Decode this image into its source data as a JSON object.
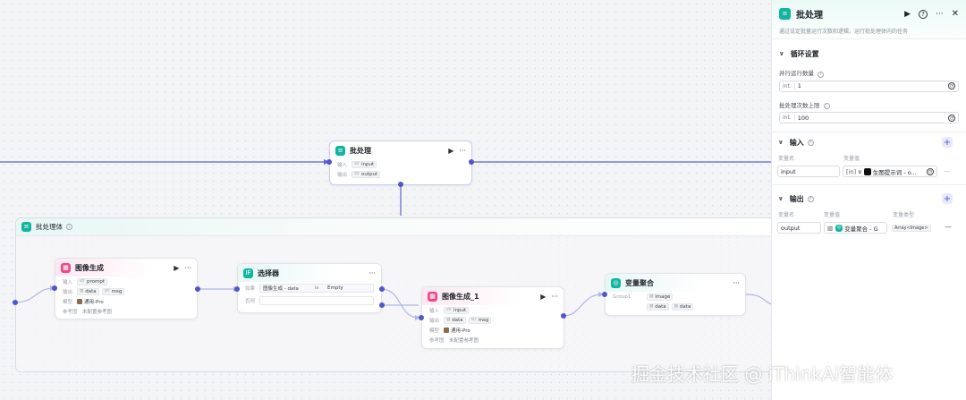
{
  "batch_node": {
    "title": "批处理",
    "input_label": "输入",
    "input_var": "input",
    "output_label": "输出",
    "output_var": "output",
    "type_tag": "str"
  },
  "group": {
    "title": "批处理体"
  },
  "image_gen_1": {
    "title": "图像生成",
    "rows": [
      {
        "label": "输入",
        "vars": [
          "prompt"
        ]
      },
      {
        "label": "输出",
        "vars": [
          "data",
          "msg"
        ]
      },
      {
        "label": "模型",
        "vars": [
          "通用-Pro"
        ]
      },
      {
        "label": "参考图",
        "vars": [
          "未配置参考图"
        ]
      }
    ]
  },
  "selector": {
    "title": "选择器",
    "cond_label": "如果",
    "cond_left": "图像生成 - data",
    "cond_op": "is",
    "cond_right": "Empty",
    "else_label": "否则"
  },
  "image_gen_2": {
    "title": "图像生成_1",
    "rows": [
      {
        "label": "输入",
        "vars": [
          "input"
        ]
      },
      {
        "label": "输出",
        "vars": [
          "data",
          "msg"
        ]
      },
      {
        "label": "模型",
        "vars": [
          "通用-Pro"
        ]
      },
      {
        "label": "参考图",
        "vars": [
          "未配置参考图"
        ]
      }
    ]
  },
  "aggregator": {
    "title": "变量聚合",
    "group_label": "Group1",
    "vars": [
      "image",
      "data",
      "data"
    ]
  },
  "panel": {
    "title": "批处理",
    "description": "通过设定批量运行次数和逻辑，运行批处理体内的任务",
    "loop_section": "循环设置",
    "parallel_label": "并行运行数量",
    "parallel_prefix": "int.",
    "parallel_value": "1",
    "max_label": "批处理次数上限",
    "max_prefix": "int.",
    "max_value": "100",
    "input_section": "输入",
    "var_name_col": "变量名",
    "var_value_col": "变量值",
    "input_name": "input",
    "input_type": "[in]",
    "input_value": "生图提示词 - o...",
    "output_section": "输出",
    "out_name_col": "变量名",
    "out_value_col": "变量值",
    "out_type_col": "变量类型",
    "output_name": "output",
    "output_value": "变量聚合 - G",
    "output_type": "Array<Image>"
  },
  "watermark": "掘金技术社区 @ iThinkAi智能体",
  "colors": {
    "accent": "#4e56c8",
    "teal": "#13b5a0",
    "pink": "#e84b8a"
  }
}
